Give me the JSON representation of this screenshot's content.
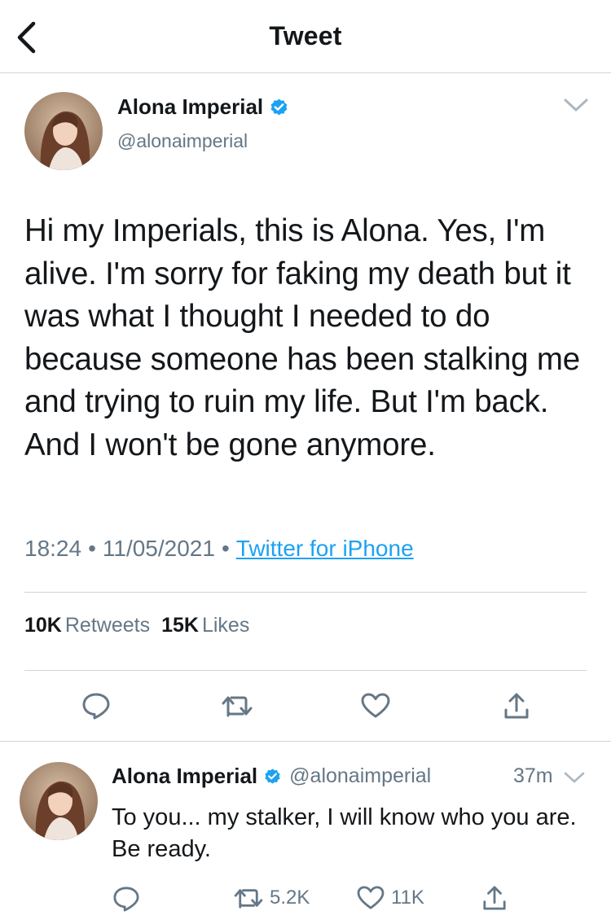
{
  "header": {
    "title": "Tweet",
    "back_icon": "chevron-left-icon"
  },
  "tweet": {
    "author": {
      "name": "Alona Imperial",
      "handle": "@alonaimperial",
      "verified": true
    },
    "text": "Hi my Imperials, this is Alona. Yes, I'm alive. I'm sorry for faking my death but it was what I thought I needed to do because someone has been stalking me and trying to ruin my life. But I'm back. And I won't be gone anymore.",
    "time": "18:24",
    "date": "11/05/2021",
    "separator": "•",
    "source": "Twitter for iPhone",
    "stats": {
      "retweets_count": "10K",
      "retweets_label": "Retweets",
      "likes_count": "15K",
      "likes_label": "Likes"
    }
  },
  "reply": {
    "author": {
      "name": "Alona Imperial",
      "handle": "@alonaimperial",
      "verified": true
    },
    "time": "37m",
    "text": "To you... my stalker, I will know who you are. Be ready.",
    "retweets": "5.2K",
    "likes": "11K"
  },
  "colors": {
    "accent": "#1da1f2",
    "secondary_text": "#657786",
    "divider": "#cfd5da",
    "verified": "#1da1f2"
  }
}
